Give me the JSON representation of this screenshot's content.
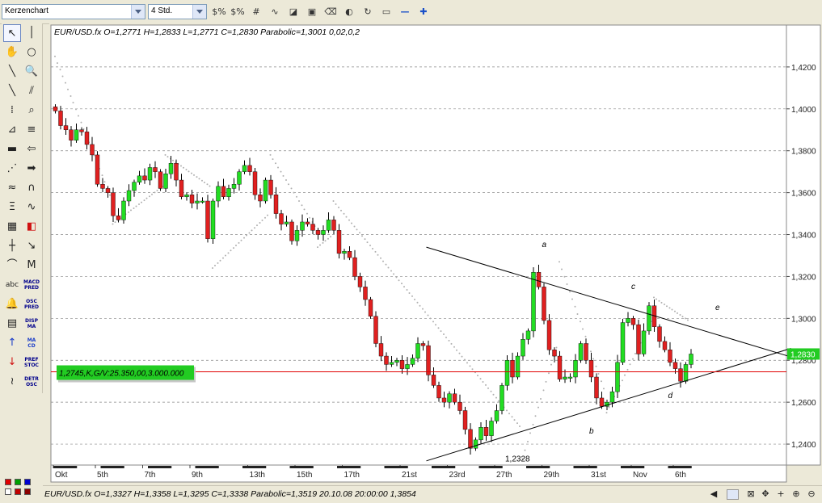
{
  "toolbar": {
    "chart_type": "Kerzenchart",
    "interval": "4 Std.",
    "tool_icons": [
      "currency-percent-icon",
      "currency-percent-alt-icon",
      "grid-icon",
      "wave-icon",
      "chart-area-icon",
      "picture-icon",
      "eraser-icon",
      "palette-icon",
      "chart-refresh-icon",
      "window-icon",
      "zoom-out-icon",
      "zoom-in-icon"
    ]
  },
  "palette": {
    "tools": [
      {
        "name": "pointer-tool",
        "glyph": "↖"
      },
      {
        "name": "vertical-line-tool",
        "glyph": "│"
      },
      {
        "name": "hand-tool",
        "glyph": "✋"
      },
      {
        "name": "circle-tool",
        "glyph": "○"
      },
      {
        "name": "trend-line-tool",
        "glyph": "╲"
      },
      {
        "name": "zoom-tool",
        "glyph": "🔍"
      },
      {
        "name": "line-tool",
        "glyph": "╲"
      },
      {
        "name": "parallel-line-tool",
        "glyph": "⫽"
      },
      {
        "name": "dotted-grid-tool",
        "glyph": "⁞"
      },
      {
        "name": "zoom-box-tool",
        "glyph": "⌕"
      },
      {
        "name": "fan-tool",
        "glyph": "⊿"
      },
      {
        "name": "horizontal-lines-tool",
        "glyph": "≡"
      },
      {
        "name": "horizontal-line-tool",
        "glyph": "▬"
      },
      {
        "name": "arrow-left-tool",
        "glyph": "⇦"
      },
      {
        "name": "speed-lines-tool",
        "glyph": "⋰"
      },
      {
        "name": "arrow-right-tool",
        "glyph": "➡"
      },
      {
        "name": "color-lines-tool",
        "glyph": "≈"
      },
      {
        "name": "cycle-tool",
        "glyph": "∩"
      },
      {
        "name": "fibonacci-tool",
        "glyph": "Ξ"
      },
      {
        "name": "wave-tool",
        "glyph": "∿"
      },
      {
        "name": "grid-tool",
        "glyph": "▦"
      },
      {
        "name": "fill-tool",
        "glyph": "◧"
      },
      {
        "name": "crosshair-tool",
        "glyph": "┼"
      },
      {
        "name": "zigzag-tool",
        "glyph": "↘"
      },
      {
        "name": "arc-tool",
        "glyph": "⌒"
      },
      {
        "name": "wave-m-tool",
        "glyph": "M"
      },
      {
        "name": "text-tool",
        "glyph": "abc"
      },
      {
        "name": "macd-pred-tool",
        "glyph": "MACD PRED"
      },
      {
        "name": "alarm-tool",
        "glyph": "🔔"
      },
      {
        "name": "osc-pred-tool",
        "glyph": "OSC PRED"
      },
      {
        "name": "calculator-tool",
        "glyph": "▤"
      },
      {
        "name": "disp-ma-tool",
        "glyph": "DISP MA"
      },
      {
        "name": "up-arrow-tool",
        "glyph": "↑"
      },
      {
        "name": "ma-cd-tool",
        "glyph": "MA CD"
      },
      {
        "name": "down-arrow-tool",
        "glyph": "↓"
      },
      {
        "name": "pref-stoc-tool",
        "glyph": "PREF STOC"
      },
      {
        "name": "squiggle-tool",
        "glyph": "≀"
      },
      {
        "name": "detr-osc-tool",
        "glyph": "DETR OSC"
      }
    ]
  },
  "chart": {
    "header": "EUR/USD.fx  O=1,2771  H=1,2833  L=1,2771  C=1,2830    Parabolic=1,3001   0,02,0,2",
    "order_label": "1,2745,K,G/V:25.350,00,3.000.000",
    "current_price": "1,2830",
    "low_label": "1,2328",
    "wave_labels": [
      "a",
      "b",
      "c",
      "d",
      "e"
    ],
    "colors": {
      "up": "#22dd22",
      "down": "#e02020",
      "psar": "#b0b0b0",
      "order_line": "#e00000",
      "price_tag": "#22cc22"
    }
  },
  "chart_data": {
    "type": "candlestick",
    "title": "EUR/USD.fx",
    "y_ticks": [
      "1,4200",
      "1,4000",
      "1,3800",
      "1,3600",
      "1,3400",
      "1,3200",
      "1,3000",
      "1,2800",
      "1,2600",
      "1,2400"
    ],
    "x_ticks": [
      "Okt",
      "5th",
      "7th",
      "9th",
      "13th",
      "15th",
      "17th",
      "21st",
      "23rd",
      "27th",
      "29th",
      "31st",
      "Nov",
      "6th"
    ],
    "ylim": [
      1.23,
      1.44
    ],
    "closes": [
      1.399,
      1.392,
      1.39,
      1.385,
      1.39,
      1.389,
      1.383,
      1.378,
      1.364,
      1.362,
      1.36,
      1.349,
      1.347,
      1.356,
      1.361,
      1.365,
      1.368,
      1.366,
      1.372,
      1.37,
      1.362,
      1.369,
      1.374,
      1.366,
      1.358,
      1.359,
      1.355,
      1.356,
      1.356,
      1.338,
      1.356,
      1.363,
      1.358,
      1.362,
      1.364,
      1.37,
      1.373,
      1.37,
      1.359,
      1.356,
      1.366,
      1.359,
      1.35,
      1.345,
      1.346,
      1.337,
      1.342,
      1.346,
      1.345,
      1.342,
      1.34,
      1.342,
      1.347,
      1.342,
      1.331,
      1.332,
      1.329,
      1.32,
      1.315,
      1.309,
      1.301,
      1.288,
      1.282,
      1.278,
      1.279,
      1.28,
      1.276,
      1.278,
      1.281,
      1.288,
      1.287,
      1.273,
      1.268,
      1.262,
      1.26,
      1.264,
      1.26,
      1.256,
      1.247,
      1.238,
      1.242,
      1.248,
      1.244,
      1.251,
      1.256,
      1.268,
      1.28,
      1.272,
      1.282,
      1.29,
      1.294,
      1.322,
      1.315,
      1.299,
      1.285,
      1.282,
      1.271,
      1.272,
      1.272,
      1.28,
      1.288,
      1.28,
      1.272,
      1.262,
      1.258,
      1.26,
      1.265,
      1.279,
      1.298,
      1.3,
      1.297,
      1.283,
      1.294,
      1.306,
      1.296,
      1.289,
      1.285,
      1.279,
      1.276,
      1.27,
      1.278,
      1.283
    ],
    "psar": [
      {
        "from": 0,
        "to": 10,
        "start": 1.425,
        "end": 1.362
      },
      {
        "from": 11,
        "to": 20,
        "start": 1.345,
        "end": 1.362
      },
      {
        "from": 21,
        "to": 29,
        "start": 1.378,
        "end": 1.364
      },
      {
        "from": 30,
        "to": 40,
        "start": 1.324,
        "end": 1.348
      },
      {
        "from": 41,
        "to": 49,
        "start": 1.378,
        "end": 1.346
      },
      {
        "from": 50,
        "to": 52,
        "start": 1.334,
        "end": 1.338
      },
      {
        "from": 53,
        "to": 88,
        "start": 1.356,
        "end": 1.25
      },
      {
        "from": 89,
        "to": 95,
        "start": 1.233,
        "end": 1.282
      },
      {
        "from": 96,
        "to": 104,
        "start": 1.327,
        "end": 1.27
      },
      {
        "from": 105,
        "to": 113,
        "start": 1.255,
        "end": 1.296
      },
      {
        "from": 114,
        "to": 120,
        "start": 1.31,
        "end": 1.3
      }
    ],
    "trendlines": [
      {
        "from": [
          71,
          1.334
        ],
        "to": [
          125,
          1.293
        ]
      },
      {
        "from": [
          71,
          1.232
        ],
        "to": [
          125,
          1.274
        ]
      }
    ],
    "order_level": 1.2745
  },
  "status": {
    "text": "EUR/USD.fx  O=1,3327  H=1,3358  L=1,3295  C=1,3338    Parabolic=1,3519     20.10.08  20:00:00  1,3854",
    "colors": [
      "#e00000",
      "#00a000",
      "#0000d0",
      "#ffffff",
      "#c00000",
      "#8b0000"
    ]
  }
}
